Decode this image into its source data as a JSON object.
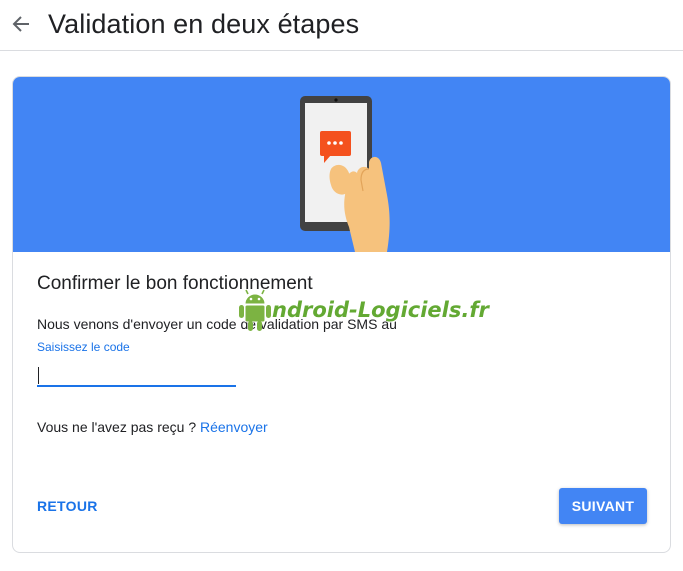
{
  "header": {
    "back_icon": "arrow-left-icon",
    "title": "Validation en deux étapes"
  },
  "card": {
    "banner_color": "#4285f4",
    "illustration_icons": [
      "phone-icon",
      "sms-bubble-icon",
      "hand-icon"
    ],
    "section_title": "Confirmer le bon fonctionnement",
    "description": "Nous venons d'envoyer un code de validation par SMS au",
    "code_field": {
      "label": "Saisissez le code",
      "value": ""
    },
    "resend": {
      "prompt": "Vous ne l'avez pas reçu ?",
      "link": "Réenvoyer"
    },
    "buttons": {
      "back": "RETOUR",
      "next": "SUIVANT"
    }
  },
  "watermark": {
    "logo_icon": "android-robot-icon",
    "text": "ndroid-Logiciels.fr"
  },
  "colors": {
    "accent": "#1a73e8",
    "primary_button": "#4285f4",
    "watermark_green": "#63a933"
  }
}
